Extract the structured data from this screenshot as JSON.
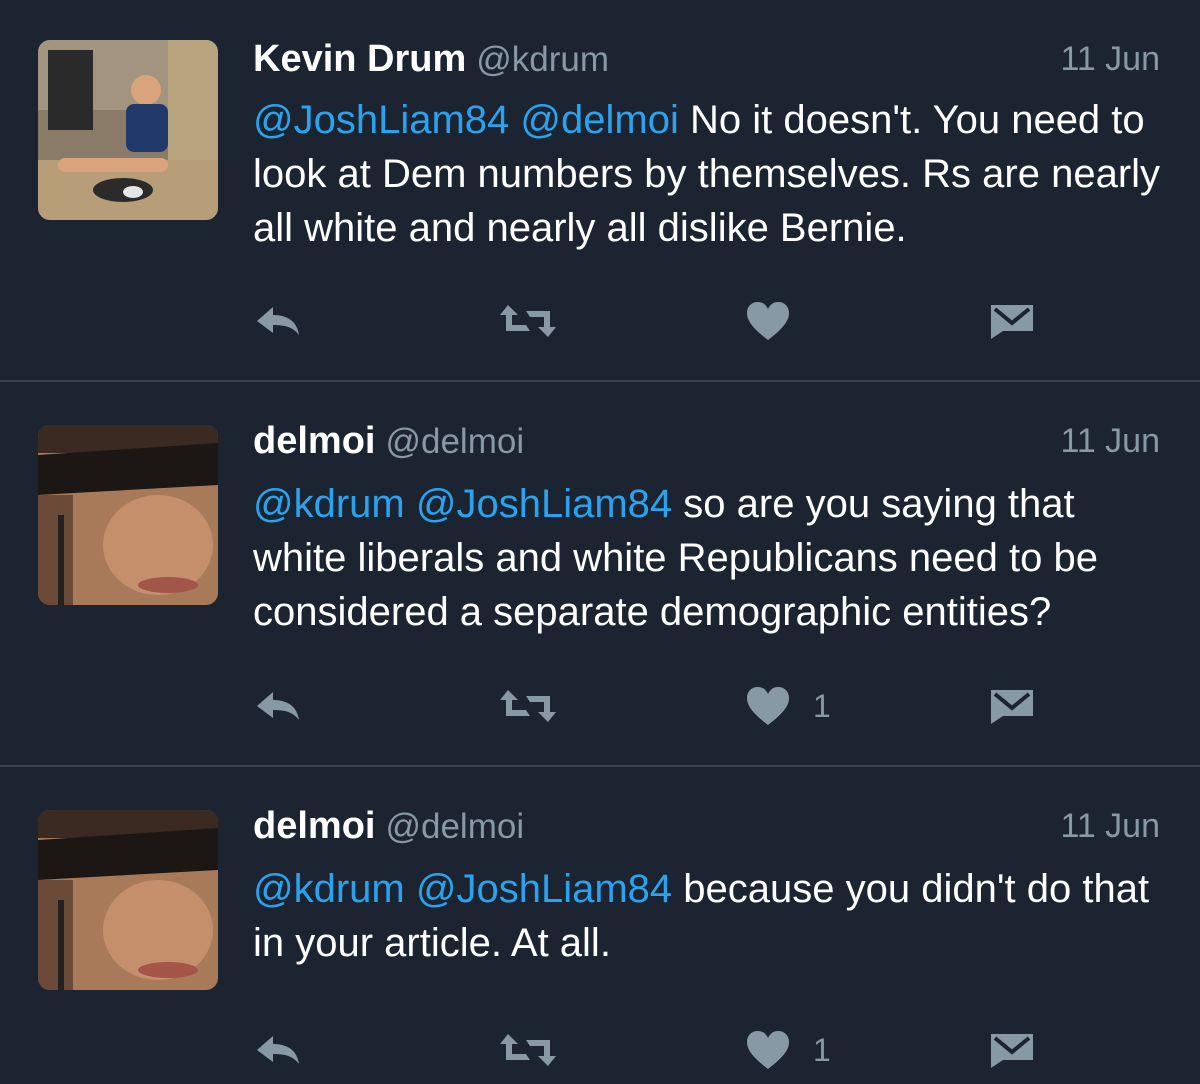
{
  "colors": {
    "background": "#1b2430",
    "divider": "#38444f",
    "mention": "#2aa3ef",
    "muted": "#8899a6",
    "text": "#ffffff"
  },
  "tweets": [
    {
      "name": "Kevin Drum",
      "handle": "@kdrum",
      "date": "11 Jun",
      "mentions": [
        "@JoshLiam84",
        "@delmoi"
      ],
      "text": "No it doesn't. You need to look at Dem numbers by themselves. Rs are nearly all white and nearly all dislike Bernie.",
      "like_count": ""
    },
    {
      "name": "delmoi",
      "handle": "@delmoi",
      "date": "11 Jun",
      "mentions": [
        "@kdrum",
        "@JoshLiam84"
      ],
      "text": "so are you saying that white liberals and white Republicans need to be considered a separate demographic entities?",
      "like_count": "1"
    },
    {
      "name": "delmoi",
      "handle": "@delmoi",
      "date": "11 Jun",
      "mentions": [
        "@kdrum",
        "@JoshLiam84"
      ],
      "text": "because you didn't do that in your article. At all.",
      "like_count": "1"
    }
  ],
  "icons": {
    "reply": "reply-icon",
    "retweet": "retweet-icon",
    "like": "heart-icon",
    "dm": "direct-message-icon"
  }
}
